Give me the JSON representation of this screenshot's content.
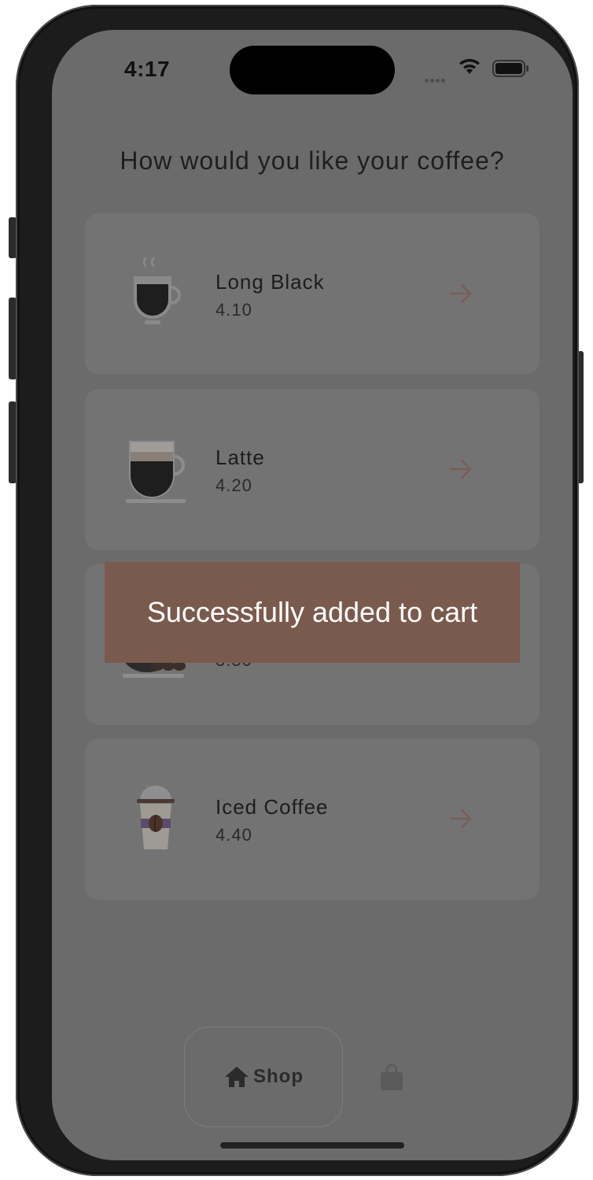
{
  "status_bar": {
    "time": "4:17"
  },
  "page": {
    "title": "How would you like your coffee?"
  },
  "products": [
    {
      "name": "Long Black",
      "price": "4.10",
      "image": "long-black-cup-icon"
    },
    {
      "name": "Latte",
      "price": "4.20",
      "image": "latte-cup-icon"
    },
    {
      "name": "",
      "price": "3.50",
      "image": "espresso-beans-cup-icon"
    },
    {
      "name": "Iced Coffee",
      "price": "4.40",
      "image": "iced-coffee-cup-icon"
    }
  ],
  "toast": {
    "message": "Successfully added to cart"
  },
  "bottom_nav": {
    "items": [
      {
        "label": "Shop",
        "icon": "home-icon",
        "active": true
      },
      {
        "label": "",
        "icon": "shopping-bag-icon",
        "active": false
      }
    ]
  },
  "colors": {
    "overlay": "#6b6b6b",
    "toast": "#7a5a4d",
    "accent": "#8c5f52"
  }
}
